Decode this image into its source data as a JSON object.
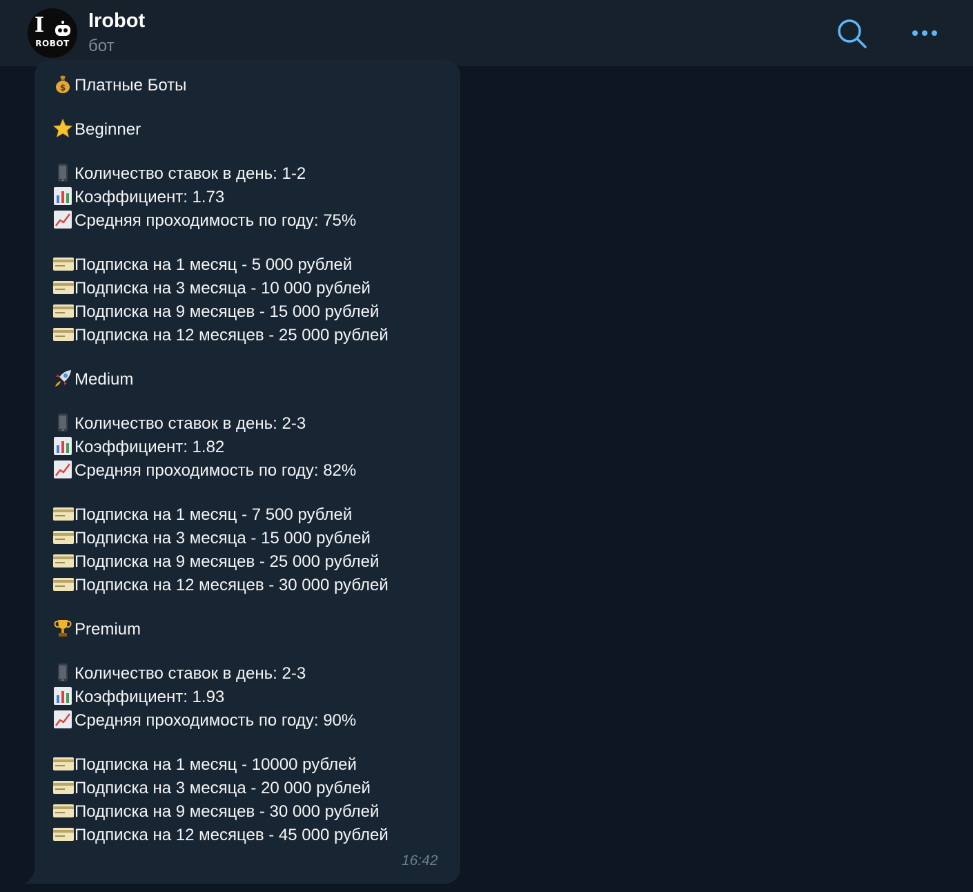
{
  "header": {
    "title": "Irobot",
    "subtitle": "бот",
    "avatar_letter": "I",
    "avatar_text": "ROBOT",
    "accent_color": "#5eb5f7"
  },
  "message": {
    "time": "16:42",
    "lines": [
      {
        "icon": "money-bag-icon",
        "text": "Платные Боты"
      },
      {
        "icon": "star-icon",
        "text": "Beginner"
      },
      {
        "icon": "phone-icon",
        "text": "Количество ставок в день: 1-2"
      },
      {
        "icon": "bar-chart-icon",
        "text": "Коэффициент: 1.73"
      },
      {
        "icon": "trend-up-icon",
        "text": "Средняя проходимость по году: 75%"
      },
      {
        "icon": "credit-card-icon",
        "text": "Подписка на 1 месяц - 5 000 рублей"
      },
      {
        "icon": "credit-card-icon",
        "text": "Подписка на 3 месяца - 10 000 рублей"
      },
      {
        "icon": "credit-card-icon",
        "text": "Подписка на 9 месяцев - 15 000 рублей"
      },
      {
        "icon": "credit-card-icon",
        "text": "Подписка на 12 месяцев - 25 000 рублей"
      },
      {
        "icon": "rocket-icon",
        "text": "Medium"
      },
      {
        "icon": "phone-icon",
        "text": "Количество ставок в день: 2-3"
      },
      {
        "icon": "bar-chart-icon",
        "text": "Коэффициент: 1.82"
      },
      {
        "icon": "trend-up-icon",
        "text": "Средняя проходимость по году: 82%"
      },
      {
        "icon": "credit-card-icon",
        "text": "Подписка на 1 месяц - 7 500 рублей"
      },
      {
        "icon": "credit-card-icon",
        "text": "Подписка на 3 месяца - 15 000 рублей"
      },
      {
        "icon": "credit-card-icon",
        "text": "Подписка на 9 месяцев - 25 000 рублей"
      },
      {
        "icon": "credit-card-icon",
        "text": "Подписка на 12 месяцев - 30 000 рублей"
      },
      {
        "icon": "trophy-icon",
        "text": "Premium"
      },
      {
        "icon": "phone-icon",
        "text": "Количество ставок в день: 2-3"
      },
      {
        "icon": "bar-chart-icon",
        "text": "Коэффициент: 1.93"
      },
      {
        "icon": "trend-up-icon",
        "text": "Средняя проходимость по году: 90%"
      },
      {
        "icon": "credit-card-icon",
        "text": "Подписка на 1 месяц - 10000 рублей"
      },
      {
        "icon": "credit-card-icon",
        "text": "Подписка на 3 месяца - 20 000 рублей"
      },
      {
        "icon": "credit-card-icon",
        "text": "Подписка на 9 месяцев - 30 000 рублей"
      },
      {
        "icon": "credit-card-icon",
        "text": "Подписка на 12 месяцев - 45 000 рублей"
      }
    ]
  }
}
